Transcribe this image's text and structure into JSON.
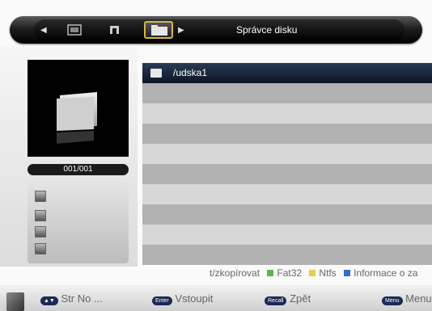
{
  "header": {
    "title": "Správce disku",
    "icons": [
      "prev-arrow-icon",
      "image-icon",
      "music-icon",
      "folder-icon",
      "next-arrow-icon"
    ],
    "selected_icon": "folder-icon"
  },
  "preview": {
    "counter": "001/001"
  },
  "categories": [
    "photo-icon",
    "person-icon",
    "folder-icon",
    "user-icon"
  ],
  "files": [
    {
      "name": "/udska1",
      "selected": true
    }
  ],
  "legend": {
    "copy_label": "t/zkopírovat",
    "items": [
      {
        "color": "#5ab84a",
        "label": "Fat32"
      },
      {
        "color": "#e6cf4a",
        "label": "Ntfs"
      },
      {
        "color": "#2f6fd1",
        "label": "Informace o za"
      }
    ]
  },
  "bottom": {
    "items": [
      {
        "key": "▲▼",
        "label": "Str No ..."
      },
      {
        "key": "Enter",
        "label": "Vstoupit"
      },
      {
        "key": "Recall",
        "label": "Zpět"
      },
      {
        "key": "Menu",
        "label": "Menu"
      }
    ]
  }
}
